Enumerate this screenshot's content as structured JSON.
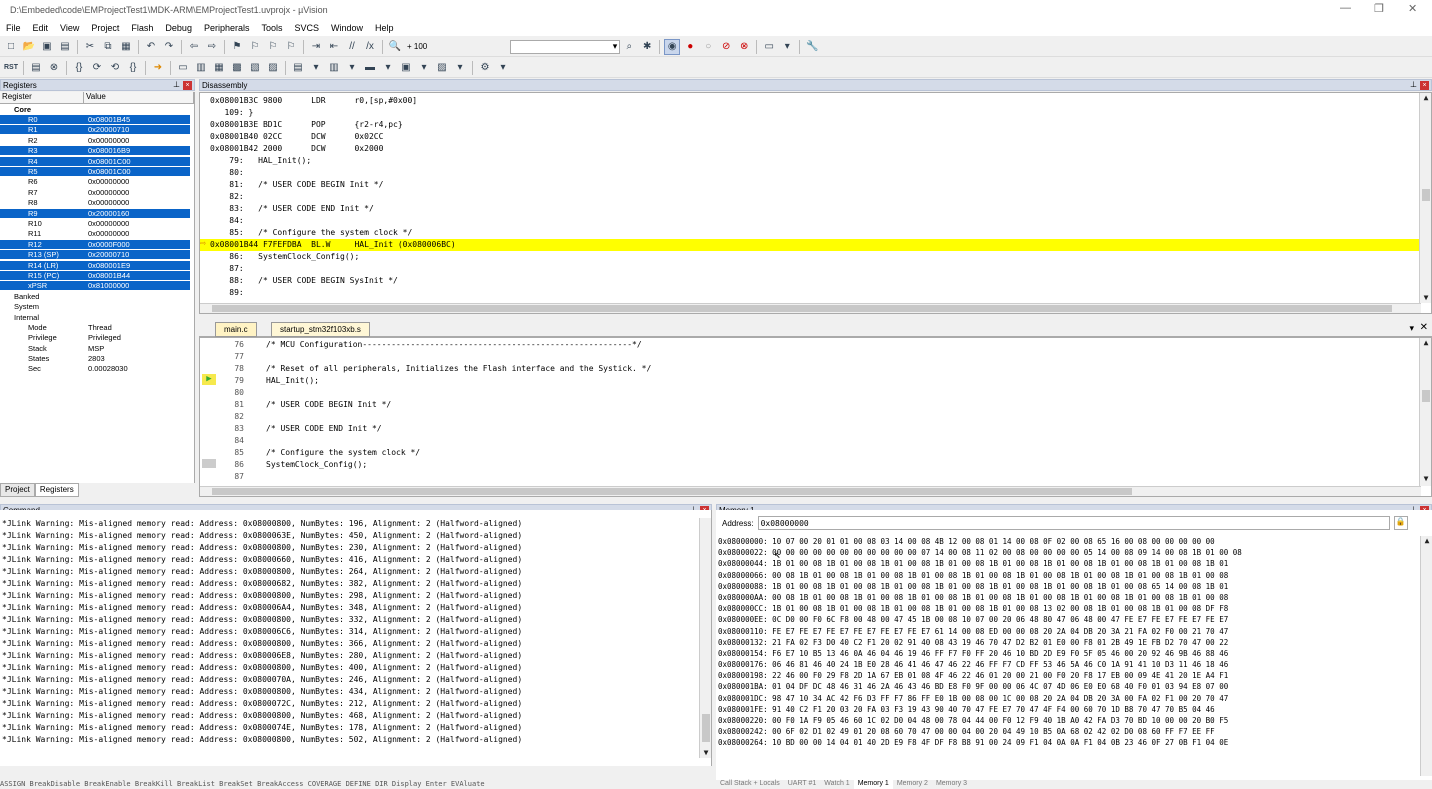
{
  "title": "D:\\Embeded\\code\\EMProjectTest1\\MDK-ARM\\EMProjectTest1.uvprojx - µVision",
  "menu": [
    "File",
    "Edit",
    "View",
    "Project",
    "Flash",
    "Debug",
    "Peripherals",
    "Tools",
    "SVCS",
    "Window",
    "Help"
  ],
  "toolbar": {
    "zoom": "+ 100",
    "rst": "RST"
  },
  "registers": {
    "header": "Registers",
    "col_name": "Register",
    "col_value": "Value",
    "rows": [
      {
        "n": "Core",
        "v": "",
        "t": "grp",
        "s": false
      },
      {
        "n": "R0",
        "v": "0x08001B45",
        "t": "r",
        "s": true
      },
      {
        "n": "R1",
        "v": "0x20000710",
        "t": "r",
        "s": true
      },
      {
        "n": "R2",
        "v": "0x00000000",
        "t": "r",
        "s": false
      },
      {
        "n": "R3",
        "v": "0x080016B9",
        "t": "r",
        "s": true
      },
      {
        "n": "R4",
        "v": "0x08001C00",
        "t": "r",
        "s": true
      },
      {
        "n": "R5",
        "v": "0x08001C00",
        "t": "r",
        "s": true
      },
      {
        "n": "R6",
        "v": "0x00000000",
        "t": "r",
        "s": false
      },
      {
        "n": "R7",
        "v": "0x00000000",
        "t": "r",
        "s": false
      },
      {
        "n": "R8",
        "v": "0x00000000",
        "t": "r",
        "s": false
      },
      {
        "n": "R9",
        "v": "0x20000160",
        "t": "r",
        "s": true
      },
      {
        "n": "R10",
        "v": "0x00000000",
        "t": "r",
        "s": false
      },
      {
        "n": "R11",
        "v": "0x00000000",
        "t": "r",
        "s": false
      },
      {
        "n": "R12",
        "v": "0x0000F000",
        "t": "r",
        "s": true
      },
      {
        "n": "R13 (SP)",
        "v": "0x20000710",
        "t": "r",
        "s": true
      },
      {
        "n": "R14 (LR)",
        "v": "0x080001E9",
        "t": "r",
        "s": true
      },
      {
        "n": "R15 (PC)",
        "v": "0x08001B44",
        "t": "r",
        "s": true
      },
      {
        "n": "xPSR",
        "v": "0x81000000",
        "t": "r",
        "s": true
      },
      {
        "n": "Banked",
        "v": "",
        "t": "l0",
        "s": false
      },
      {
        "n": "System",
        "v": "",
        "t": "l0",
        "s": false
      },
      {
        "n": "Internal",
        "v": "",
        "t": "l0",
        "s": false
      },
      {
        "n": "Mode",
        "v": "Thread",
        "t": "r",
        "s": false
      },
      {
        "n": "Privilege",
        "v": "Privileged",
        "t": "r",
        "s": false
      },
      {
        "n": "Stack",
        "v": "MSP",
        "t": "r",
        "s": false
      },
      {
        "n": "States",
        "v": "2803",
        "t": "r",
        "s": false
      },
      {
        "n": "Sec",
        "v": "0.00028030",
        "t": "r",
        "s": false
      }
    ],
    "tab_project": "Project",
    "tab_registers": "Registers"
  },
  "disassembly": {
    "header": "Disassembly",
    "lines": [
      {
        "t": "0x08001B3C 9800      LDR      r0,[sp,#0x00]",
        "h": false
      },
      {
        "t": "   109: }",
        "h": false
      },
      {
        "t": "0x08001B3E BD1C      POP      {r2-r4,pc}",
        "h": false
      },
      {
        "t": "0x08001B40 02CC      DCW      0x02CC",
        "h": false
      },
      {
        "t": "0x08001B42 2000      DCW      0x2000",
        "h": false
      },
      {
        "t": "    79:   HAL_Init();",
        "h": false
      },
      {
        "t": "    80:",
        "h": false
      },
      {
        "t": "    81:   /* USER CODE BEGIN Init */",
        "h": false
      },
      {
        "t": "    82:",
        "h": false
      },
      {
        "t": "    83:   /* USER CODE END Init */",
        "h": false
      },
      {
        "t": "    84:",
        "h": false
      },
      {
        "t": "    85:   /* Configure the system clock */",
        "h": false
      },
      {
        "t": "0x08001B44 F7FEFDBA  BL.W     HAL_Init (0x080006BC)",
        "h": true
      },
      {
        "t": "    86:   SystemClock_Config();",
        "h": false
      },
      {
        "t": "    87:",
        "h": false
      },
      {
        "t": "    88:   /* USER CODE BEGIN SysInit */",
        "h": false
      },
      {
        "t": "    89:",
        "h": false
      }
    ]
  },
  "editor": {
    "tab1": "main.c",
    "tab2": "startup_stm32f103xb.s",
    "lines": [
      {
        "n": "76",
        "t": "/* MCU Configuration--------------------------------------------------------*/"
      },
      {
        "n": "77",
        "t": ""
      },
      {
        "n": "78",
        "t": "/* Reset of all peripherals, Initializes the Flash interface and the Systick. */"
      },
      {
        "n": "79",
        "t": "HAL_Init();"
      },
      {
        "n": "80",
        "t": ""
      },
      {
        "n": "81",
        "t": "/* USER CODE BEGIN Init */"
      },
      {
        "n": "82",
        "t": ""
      },
      {
        "n": "83",
        "t": "/* USER CODE END Init */"
      },
      {
        "n": "84",
        "t": ""
      },
      {
        "n": "85",
        "t": "/* Configure the system clock */"
      },
      {
        "n": "86",
        "t": "SystemClock_Config();"
      },
      {
        "n": "87",
        "t": ""
      }
    ]
  },
  "command": {
    "header": "Command",
    "lines": [
      "*JLink Warning: Mis-aligned memory read: Address: 0x08000800, NumBytes: 196, Alignment: 2 (Halfword-aligned)",
      "*JLink Warning: Mis-aligned memory read: Address: 0x0800063E, NumBytes: 450, Alignment: 2 (Halfword-aligned)",
      "*JLink Warning: Mis-aligned memory read: Address: 0x08000800, NumBytes: 230, Alignment: 2 (Halfword-aligned)",
      "*JLink Warning: Mis-aligned memory read: Address: 0x08000660, NumBytes: 416, Alignment: 2 (Halfword-aligned)",
      "*JLink Warning: Mis-aligned memory read: Address: 0x08000800, NumBytes: 264, Alignment: 2 (Halfword-aligned)",
      "*JLink Warning: Mis-aligned memory read: Address: 0x08000682, NumBytes: 382, Alignment: 2 (Halfword-aligned)",
      "*JLink Warning: Mis-aligned memory read: Address: 0x08000800, NumBytes: 298, Alignment: 2 (Halfword-aligned)",
      "*JLink Warning: Mis-aligned memory read: Address: 0x080006A4, NumBytes: 348, Alignment: 2 (Halfword-aligned)",
      "*JLink Warning: Mis-aligned memory read: Address: 0x08000800, NumBytes: 332, Alignment: 2 (Halfword-aligned)",
      "*JLink Warning: Mis-aligned memory read: Address: 0x080006C6, NumBytes: 314, Alignment: 2 (Halfword-aligned)",
      "*JLink Warning: Mis-aligned memory read: Address: 0x08000800, NumBytes: 366, Alignment: 2 (Halfword-aligned)",
      "*JLink Warning: Mis-aligned memory read: Address: 0x080006E8, NumBytes: 280, Alignment: 2 (Halfword-aligned)",
      "*JLink Warning: Mis-aligned memory read: Address: 0x08000800, NumBytes: 400, Alignment: 2 (Halfword-aligned)",
      "*JLink Warning: Mis-aligned memory read: Address: 0x0800070A, NumBytes: 246, Alignment: 2 (Halfword-aligned)",
      "*JLink Warning: Mis-aligned memory read: Address: 0x08000800, NumBytes: 434, Alignment: 2 (Halfword-aligned)",
      "*JLink Warning: Mis-aligned memory read: Address: 0x0800072C, NumBytes: 212, Alignment: 2 (Halfword-aligned)",
      "*JLink Warning: Mis-aligned memory read: Address: 0x08000800, NumBytes: 468, Alignment: 2 (Halfword-aligned)",
      "*JLink Warning: Mis-aligned memory read: Address: 0x0800074E, NumBytes: 178, Alignment: 2 (Halfword-aligned)",
      "*JLink Warning: Mis-aligned memory read: Address: 0x08000800, NumBytes: 502, Alignment: 2 (Halfword-aligned)"
    ],
    "cmdline": "ASSIGN BreakDisable BreakEnable BreakKill BreakList BreakSet BreakAccess COVERAGE DEFINE DIR Display Enter EVAluate"
  },
  "memory": {
    "header": "Memory 1",
    "address_label": "Address:",
    "address_value": "0x08000000",
    "lines": [
      "0x08000000: 10 07 00 20 01 01 00 08 03 14 00 08 4B 12 00 08 01 14 00 08 0F 02 00 08 65 16 00 08 00 00 00 00 00",
      "0x08000022: 00 00 00 00 00 00 00 00 00 00 00 07 14 00 08 11 02 00 08 00 00 00 00 05 14 00 08 09 14 00 08 1B 01 00 08",
      "0x08000044: 1B 01 00 08 1B 01 00 08 1B 01 00 08 1B 01 00 08 1B 01 00 08 1B 01 00 08 1B 01 00 08 1B 01 00 08 1B 01",
      "0x08000066: 00 08 1B 01 00 08 1B 01 00 08 1B 01 00 08 1B 01 00 08 1B 01 00 08 1B 01 00 08 1B 01 00 08 1B 01 00 08",
      "0x08000088: 1B 01 00 08 1B 01 00 08 1B 01 00 08 1B 01 00 08 1B 01 00 08 1B 01 00 08 1B 01 00 08 65 14 00 08 1B 01",
      "0x080000AA: 00 08 1B 01 00 08 1B 01 00 08 1B 01 00 08 1B 01 00 08 1B 01 00 08 1B 01 00 08 1B 01 00 08 1B 01 00 08",
      "0x080000CC: 1B 01 00 08 1B 01 00 08 1B 01 00 08 1B 01 00 08 1B 01 00 08 13 02 00 08 1B 01 00 08 1B 01 00 08 DF F8",
      "0x080000EE: 0C D0 00 F0 6C F8 00 48 00 47 45 1B 00 08 10 07 00 20 06 48 80 47 06 48 00 47 FE E7 FE E7 FE E7 FE E7",
      "0x08000110: FE E7 FE E7 FE E7 FE E7 FE E7 FE E7 61 14 00 08 ED 00 00 08 20 2A 04 DB 20 3A 21 FA 02 F0 00 21 70 47",
      "0x08000132: 21 FA 02 F3 D0 40 C2 F1 20 02 91 40 08 43 19 46 70 47 D2 B2 01 E0 00 F8 01 2B 49 1E FB D2 70 47 00 22",
      "0x08000154: F6 E7 10 B5 13 46 0A 46 04 46 19 46 FF F7 F0 FF 20 46 10 BD 2D E9 F0 5F 05 46 00 20 92 46 9B 46 88 46",
      "0x08000176: 06 46 81 46 40 24 1B E0 28 46 41 46 47 46 22 46 FF F7 CD FF 53 46 5A 46 C0 1A 91 41 10 D3 11 46 18 46",
      "0x08000198: 22 46 00 F0 29 F8 2D 1A 67 EB 01 08 4F 46 22 46 01 20 00 21 00 F0 20 F8 17 EB 00 09 4E 41 20 1E A4 F1",
      "0x080001BA: 01 04 DF DC 48 46 31 46 2A 46 43 46 BD E8 F0 9F 00 00 06 4C 07 4D 06 E0 E0 68 40 F0 01 03 94 E8 07 00",
      "0x080001DC: 98 47 10 34 AC 42 F6 D3 FF F7 86 FF E0 1B 00 08 00 1C 00 08 20 2A 04 DB 20 3A 00 FA 02 F1 00 20 70 47",
      "0x080001FE: 91 40 C2 F1 20 03 20 FA 03 F3 19 43 90 40 70 47 FE E7 70 47 4F F4 00 60 70 1D B8 70 47 70 B5 04 46",
      "0x08000220: 00 F0 1A F9 05 46 60 1C 02 D0 04 48 00 78 04 44 00 F0 12 F9 40 1B A0 42 FA D3 70 BD 10 00 00 20 B0 F5",
      "0x08000242: 00 6F 02 D1 02 49 01 20 08 60 70 47 00 00 04 00 20 04 49 10 B5 0A 68 02 42 02 D0 08 60 FF F7 EE FF",
      "0x08000264: 10 BD 00 00 14 04 01 40 2D E9 F8 4F DF F8 B8 91 00 24 09 F1 04 0A 0A F1 04 0B 23 46 0F 27 0B F1 04 0E"
    ]
  },
  "bottom_tabs": [
    "Call Stack + Locals",
    "UART #1",
    "Watch 1",
    "Memory 1",
    "Memory 2",
    "Memory 3"
  ],
  "colors": {
    "selection": "#0a64c8",
    "highlight": "#ffff00",
    "panel_header": "#d4dbe8"
  }
}
